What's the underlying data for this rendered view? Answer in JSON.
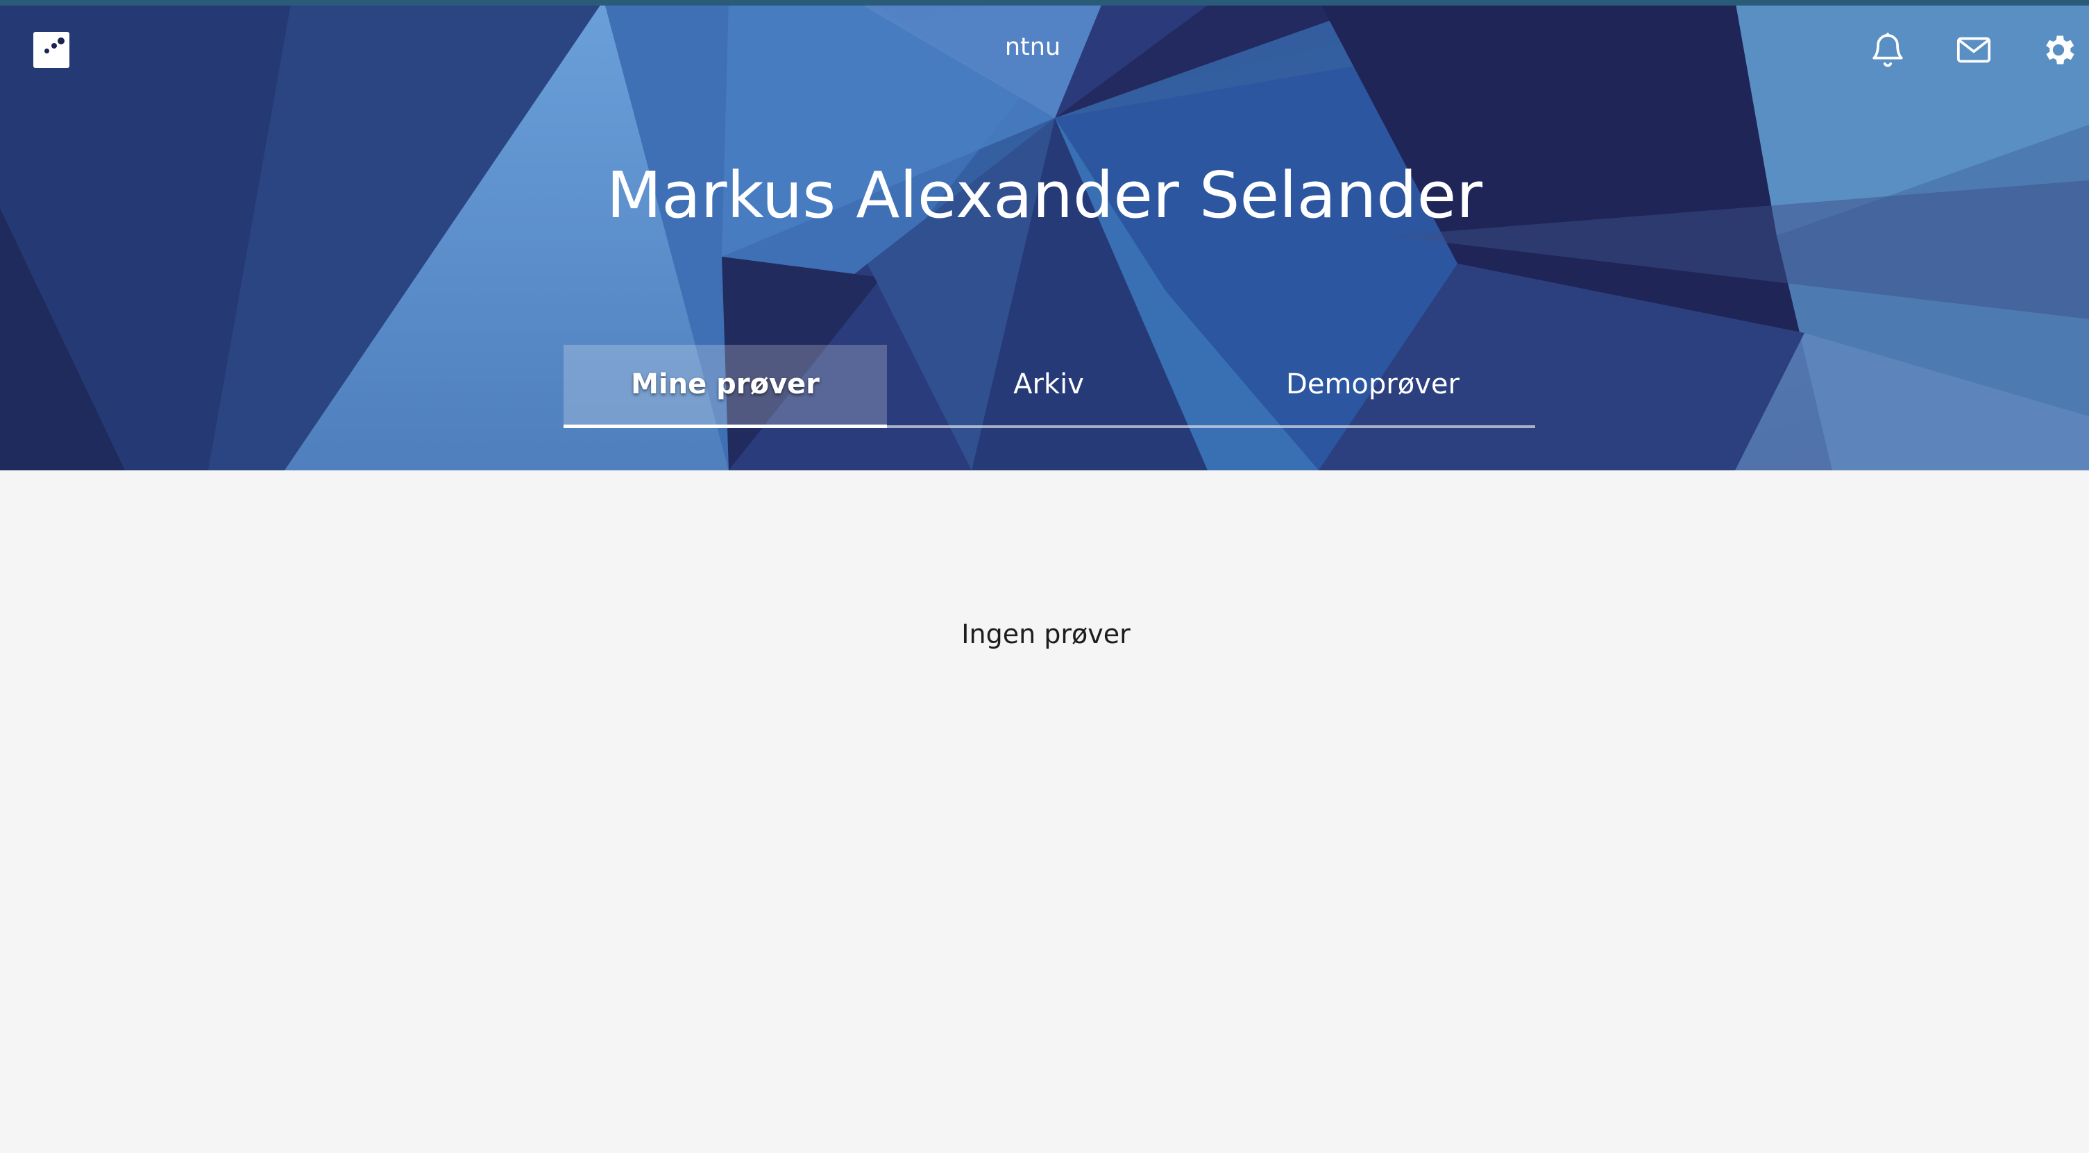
{
  "header": {
    "brand": "ntnu",
    "icons": [
      "logo-icon",
      "bell-icon",
      "mail-icon",
      "gear-icon"
    ]
  },
  "profile": {
    "name": "Markus Alexander Selander"
  },
  "tabs": [
    {
      "label": "Mine prøver",
      "active": true
    },
    {
      "label": "Arkiv",
      "active": false
    },
    {
      "label": "Demoprøver",
      "active": false
    }
  ],
  "main": {
    "empty_message": "Ingen prøver"
  },
  "colors": {
    "hero_base": "#2d4a86",
    "hero_dark": "#1e2657",
    "hero_light": "#6a9fd8",
    "background": "#f5f5f5",
    "text": "#1d1d1d"
  }
}
